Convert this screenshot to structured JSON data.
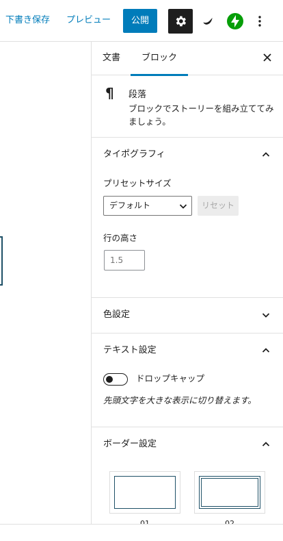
{
  "toolbar": {
    "save_draft": "下書き保存",
    "preview": "プレビュー",
    "publish": "公開",
    "icons": {
      "settings": "gear-icon",
      "theme": "brush-icon",
      "jetpack": "bolt-icon",
      "more": "vertical-ellipsis-icon"
    },
    "colors": {
      "accent": "#007cba",
      "jetpack_green": "#069e08",
      "settings_bg": "#1e1e1e"
    }
  },
  "sidebar": {
    "tabs": [
      {
        "label": "文書",
        "active": false
      },
      {
        "label": "ブロック",
        "active": true
      }
    ],
    "block": {
      "icon": "¶",
      "title": "段落",
      "description": "ブロックでストーリーを組み立ててみましょう。"
    },
    "typography": {
      "title": "タイポグラフィ",
      "preset_size_label": "プリセットサイズ",
      "preset_size_value": "デフォルト",
      "reset_label": "リセット",
      "line_height_label": "行の高さ",
      "line_height_placeholder": "1.5"
    },
    "color_settings": {
      "title": "色設定"
    },
    "text_settings": {
      "title": "テキスト設定",
      "drop_cap_label": "ドロップキャップ",
      "drop_cap_help": "先頭文字を大きな表示に切り替えます。"
    },
    "border_settings": {
      "title": "ボーダー設定",
      "options": [
        {
          "caption": "01"
        },
        {
          "caption": "02"
        }
      ]
    }
  }
}
